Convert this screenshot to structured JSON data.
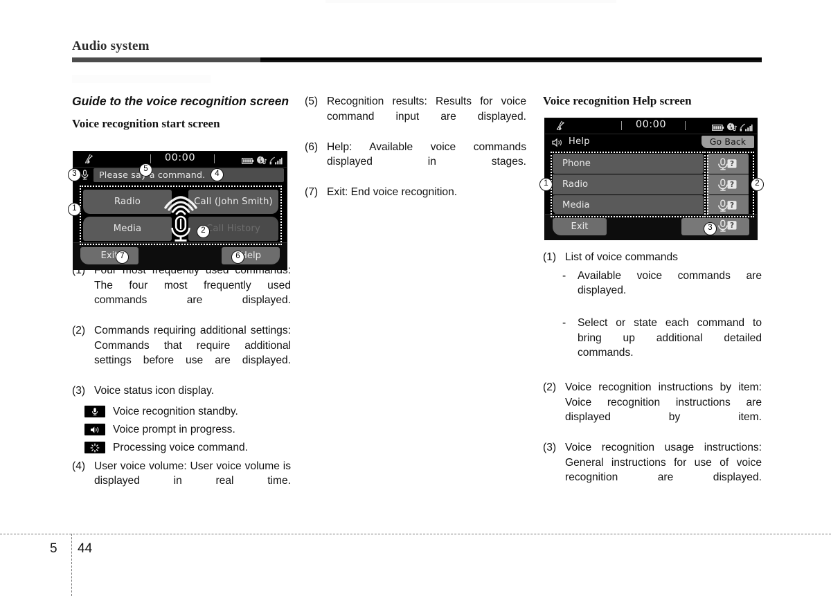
{
  "page": {
    "running_head": "Audio system",
    "chapter": "5",
    "folio": "44"
  },
  "left_column": {
    "section_title": "Guide to the voice recognition screen",
    "subsection_title": "Voice recognition start screen",
    "items": [
      {
        "marker": "(1)",
        "text": "Four most frequently used commands: The four most frequently used commands are displayed."
      },
      {
        "marker": "(2)",
        "text": "Commands requiring additional settings: Commands that require additional settings before use are displayed."
      },
      {
        "marker": "(3)",
        "text": "Voice status icon display."
      }
    ],
    "status_icons": [
      {
        "icon": "microphone-icon",
        "label": "Voice recognition standby."
      },
      {
        "icon": "speaker-icon",
        "label": "Voice prompt in progress."
      },
      {
        "icon": "spinner-icon",
        "label": "Processing voice command."
      }
    ],
    "item4": {
      "marker": "(4)",
      "text": "User voice volume: User voice volume is displayed in real time."
    }
  },
  "middle_column": {
    "items": [
      {
        "marker": "(5)",
        "text": "Recognition results: Results for voice command input are displayed."
      },
      {
        "marker": "(6)",
        "text": "Help: Available voice commands displayed in stages."
      },
      {
        "marker": "(7)",
        "text": "Exit: End voice recognition."
      }
    ]
  },
  "right_column": {
    "subsection_title": "Voice recognition Help screen",
    "items": [
      {
        "marker": "(1)",
        "text": "List of voice commands"
      },
      {
        "marker": "(2)",
        "text": "Voice recognition instructions by item: Voice recognition instructions are displayed by item."
      },
      {
        "marker": "(3)",
        "text": "Voice recognition usage instructions: General instructions for use of voice recognition are displayed."
      }
    ],
    "sub_items": [
      {
        "dash": "-",
        "text": "Available voice commands are displayed."
      },
      {
        "dash": "-",
        "text": "Select or state each command to bring up additional detailed commands."
      }
    ]
  },
  "screen_start": {
    "status_bar": {
      "clock": "00:00",
      "left_icon": "mic-mute-icon",
      "right_icons": [
        "battery-icon",
        "bluetooth-audio-icon",
        "signal-bars-icon"
      ]
    },
    "prompt": {
      "icon": "microphone-icon",
      "value": "Please say a command."
    },
    "tiles": [
      {
        "label": "Radio",
        "state": "enabled"
      },
      {
        "label": "Call (John Smith)",
        "state": "enabled"
      },
      {
        "label": "Media",
        "state": "enabled"
      },
      {
        "label": "Call History",
        "state": "dimmed"
      }
    ],
    "center_icon": "microphone-with-waves-icon",
    "exit_label": "Exit",
    "help_label": "Help",
    "callouts": [
      "1",
      "2",
      "3",
      "4",
      "5",
      "6",
      "7"
    ]
  },
  "screen_help": {
    "status_bar": {
      "clock": "00:00",
      "left_icon": "mic-mute-icon",
      "right_icons": [
        "battery-icon",
        "bluetooth-audio-icon",
        "signal-bars-icon"
      ]
    },
    "title": "Help",
    "title_icon": "speaker-icon",
    "go_back_label": "Go Back",
    "rows": [
      "Phone",
      "Radio",
      "Media"
    ],
    "row_help_icon": "mic-question-icon",
    "exit_label": "Exit",
    "exit_help_icon": "mic-question-icon",
    "callouts": [
      "1",
      "2",
      "3"
    ]
  },
  "colors": {
    "page_background": "#ffffff",
    "rule_dark": "#4c4c4c",
    "screen_background": "#000000",
    "tile_gray": "#5a5a5a",
    "button_gray": "#6d6d6d",
    "text_light": "#eaeaea"
  }
}
